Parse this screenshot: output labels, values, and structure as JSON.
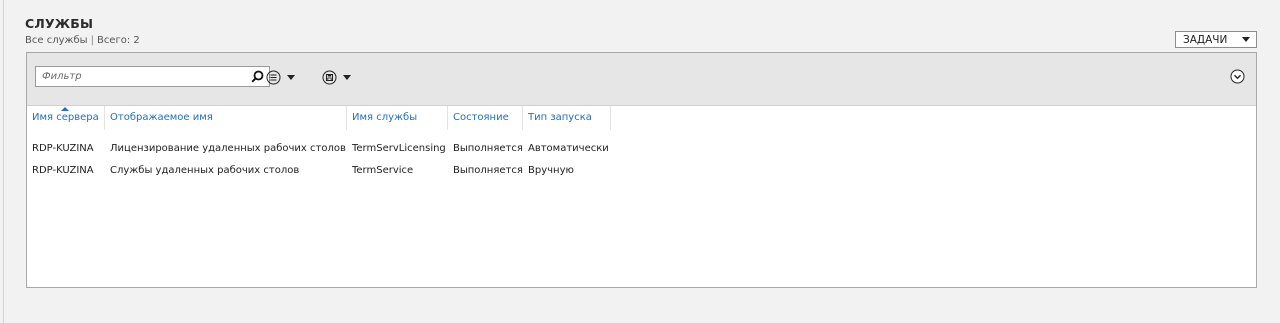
{
  "tile": {
    "title": "СЛУЖБЫ",
    "subtitle_scope": "Все службы",
    "subtitle_sep": "|",
    "subtitle_count": "Всего: 2",
    "tasks_label": "ЗАДАЧИ"
  },
  "toolbar": {
    "filter_placeholder": "Фильтр",
    "filter_value": "",
    "icons": {
      "search": "search-icon",
      "view_options": "list-options-icon",
      "save_query": "save-query-icon",
      "expand": "chevron-down-circle-icon"
    }
  },
  "grid": {
    "columns": [
      {
        "label": "Имя сервера"
      },
      {
        "label": "Отображаемое имя"
      },
      {
        "label": "Имя службы"
      },
      {
        "label": "Состояние"
      },
      {
        "label": "Тип запуска"
      }
    ],
    "rows": [
      [
        "RDP-KUZINA",
        "Лицензирование удаленных рабочих столов",
        "TermServLicensing",
        "Выполняется",
        "Автоматически"
      ],
      [
        "RDP-KUZINA",
        "Службы удаленных рабочих столов",
        "TermService",
        "Выполняется",
        "Вручную"
      ]
    ]
  },
  "colors": {
    "accent": "#1e6fc3",
    "background": "#f2f2f2",
    "toolbar": "#e6e6e6"
  }
}
